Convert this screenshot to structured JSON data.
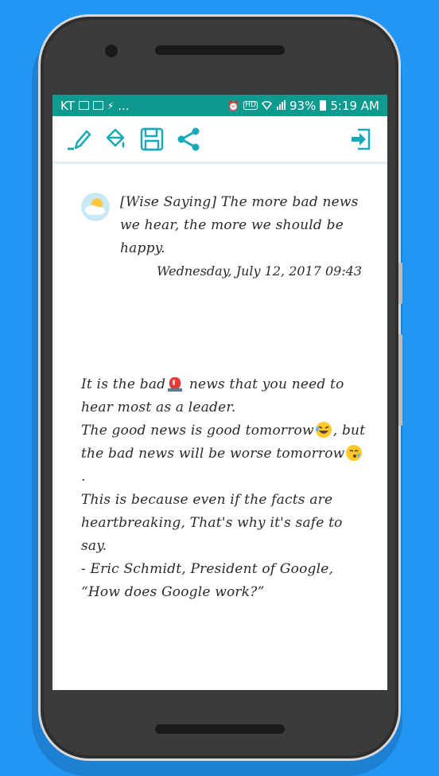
{
  "statusbar": {
    "carrier": "KT",
    "more": "...",
    "hd": "HD",
    "battery": "93%",
    "time": "5:19 AM"
  },
  "toolbar": {
    "icons": [
      "edit-icon",
      "paint-bucket-icon",
      "save-icon",
      "share-icon",
      "exit-icon"
    ]
  },
  "note": {
    "saying": "[Wise Saying] The more bad news we hear, the more we should be happy.",
    "date": "Wednesday, July 12, 2017 09:43",
    "line1a": "It is the bad",
    "line1b": " news that you need to hear most as a leader.",
    "line2a": "The good news is good tomorrow",
    "line2b": ", but the bad news will be worse tomorrow",
    "line2c": ".",
    "line3": "This is because even if the facts are heartbreaking, That's why it's safe to say.",
    "line4": "- Eric Schmidt, President of Google,",
    "line5": "“How does Google work?”"
  },
  "colors": {
    "background": "#2196f3",
    "accent": "#0e9a8f",
    "icon": "#1aa9b8"
  }
}
